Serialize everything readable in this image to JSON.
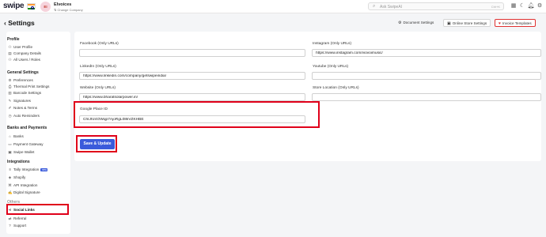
{
  "header": {
    "logo": "swipe",
    "avatar_initials": "EI",
    "company_name": "Elvoices",
    "change_company": "⇅ Change Company",
    "search_placeholder": "Ask SwipeAI",
    "search_shortcut": "Ctrl+K",
    "search_icon": "search-icon",
    "icons": [
      "grid-icon",
      "moon-icon",
      "bell-icon",
      "gear-icon"
    ]
  },
  "page": {
    "back_icon": "‹",
    "title": "Settings",
    "buttons": {
      "document_settings": "Document Settings",
      "online_store_settings": "Online Store Settings",
      "invoice_templates": "Invoice Templates"
    }
  },
  "sidebar": {
    "sections": [
      {
        "title": "Profile",
        "items": [
          "User Profile",
          "Company Details",
          "All Users / Roles"
        ]
      },
      {
        "title": "General Settings",
        "items": [
          "Preferences",
          "Thermal Print Settings",
          "Barcode Settings",
          "Signatures",
          "Notes & Terms",
          "Auto Reminders"
        ]
      },
      {
        "title": "Banks and Payments",
        "items": [
          "Banks",
          "Payment Gateway",
          "Swipe Wallet"
        ]
      },
      {
        "title": "Integrations",
        "items": [
          "Tally Integration",
          "Shopify",
          "API Integration",
          "Digital Signature"
        ]
      },
      {
        "title": "Others",
        "items": [
          "Social Links",
          "Referral",
          "Support"
        ]
      }
    ],
    "new_badge": "new",
    "active_item": "Social Links"
  },
  "form": {
    "facebook": {
      "label": "Facebook (Only URLs)",
      "value": ""
    },
    "instagram": {
      "label": "Instagram (Only URLs)",
      "value": "https://www.instagram.com/viovoimusic/"
    },
    "linkedin": {
      "label": "LinkedIn (Only URLs)",
      "value": "https://www.linkedin.com/company/getswipeindia/"
    },
    "youtube": {
      "label": "Youtube (Only URLs)",
      "value": ""
    },
    "website": {
      "label": "Website (Only URLs)",
      "value": "https://www.bharatsolarpower.in/"
    },
    "store_location": {
      "label": "Store Location (Only URLs)",
      "value": ""
    },
    "google_place_id": {
      "label": "Google Place ID",
      "value": "ChIJhz4OWqp7AjoRgL08kVZKHBE"
    },
    "save_button": "Save & Update"
  },
  "colors": {
    "primary": "#3b5bdb",
    "highlight": "#e0001a",
    "heart": "#e03131"
  }
}
